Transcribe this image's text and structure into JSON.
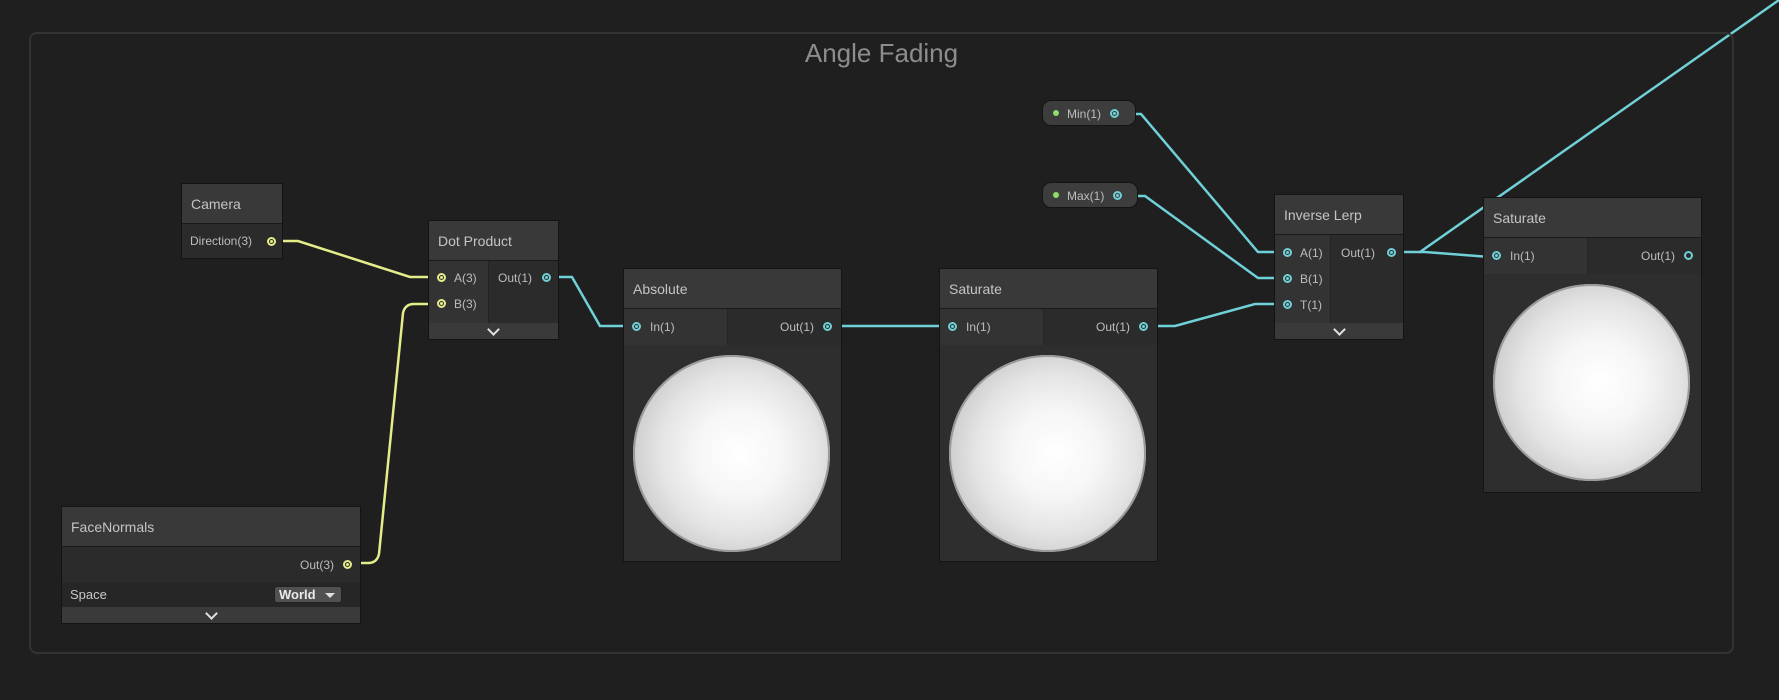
{
  "group": {
    "title": "Angle Fading"
  },
  "nodes": {
    "camera": {
      "title": "Camera",
      "out_label": "Direction(3)"
    },
    "face_normals": {
      "title": "FaceNormals",
      "out_label": "Out(3)",
      "space_label": "Space",
      "space_value": "World"
    },
    "dot_product": {
      "title": "Dot Product",
      "in_a": "A(3)",
      "in_b": "B(3)",
      "out_label": "Out(1)"
    },
    "absolute": {
      "title": "Absolute",
      "in_label": "In(1)",
      "out_label": "Out(1)"
    },
    "saturate1": {
      "title": "Saturate",
      "in_label": "In(1)",
      "out_label": "Out(1)"
    },
    "min_prop": {
      "label": "Min(1)"
    },
    "max_prop": {
      "label": "Max(1)"
    },
    "inverse_lerp": {
      "title": "Inverse Lerp",
      "in_a": "A(1)",
      "in_b": "B(1)",
      "in_t": "T(1)",
      "out_label": "Out(1)"
    },
    "saturate2": {
      "title": "Saturate",
      "in_label": "In(1)",
      "out_label": "Out(1)"
    }
  },
  "icons": {
    "expander": "chevron-down-icon",
    "dropdown": "triangle-down-icon"
  },
  "colors": {
    "vector3_port": "#e5ec8a",
    "float_port": "#6fd0d8",
    "property_dot": "#8fdc6a",
    "background": "#1f1f1f"
  }
}
